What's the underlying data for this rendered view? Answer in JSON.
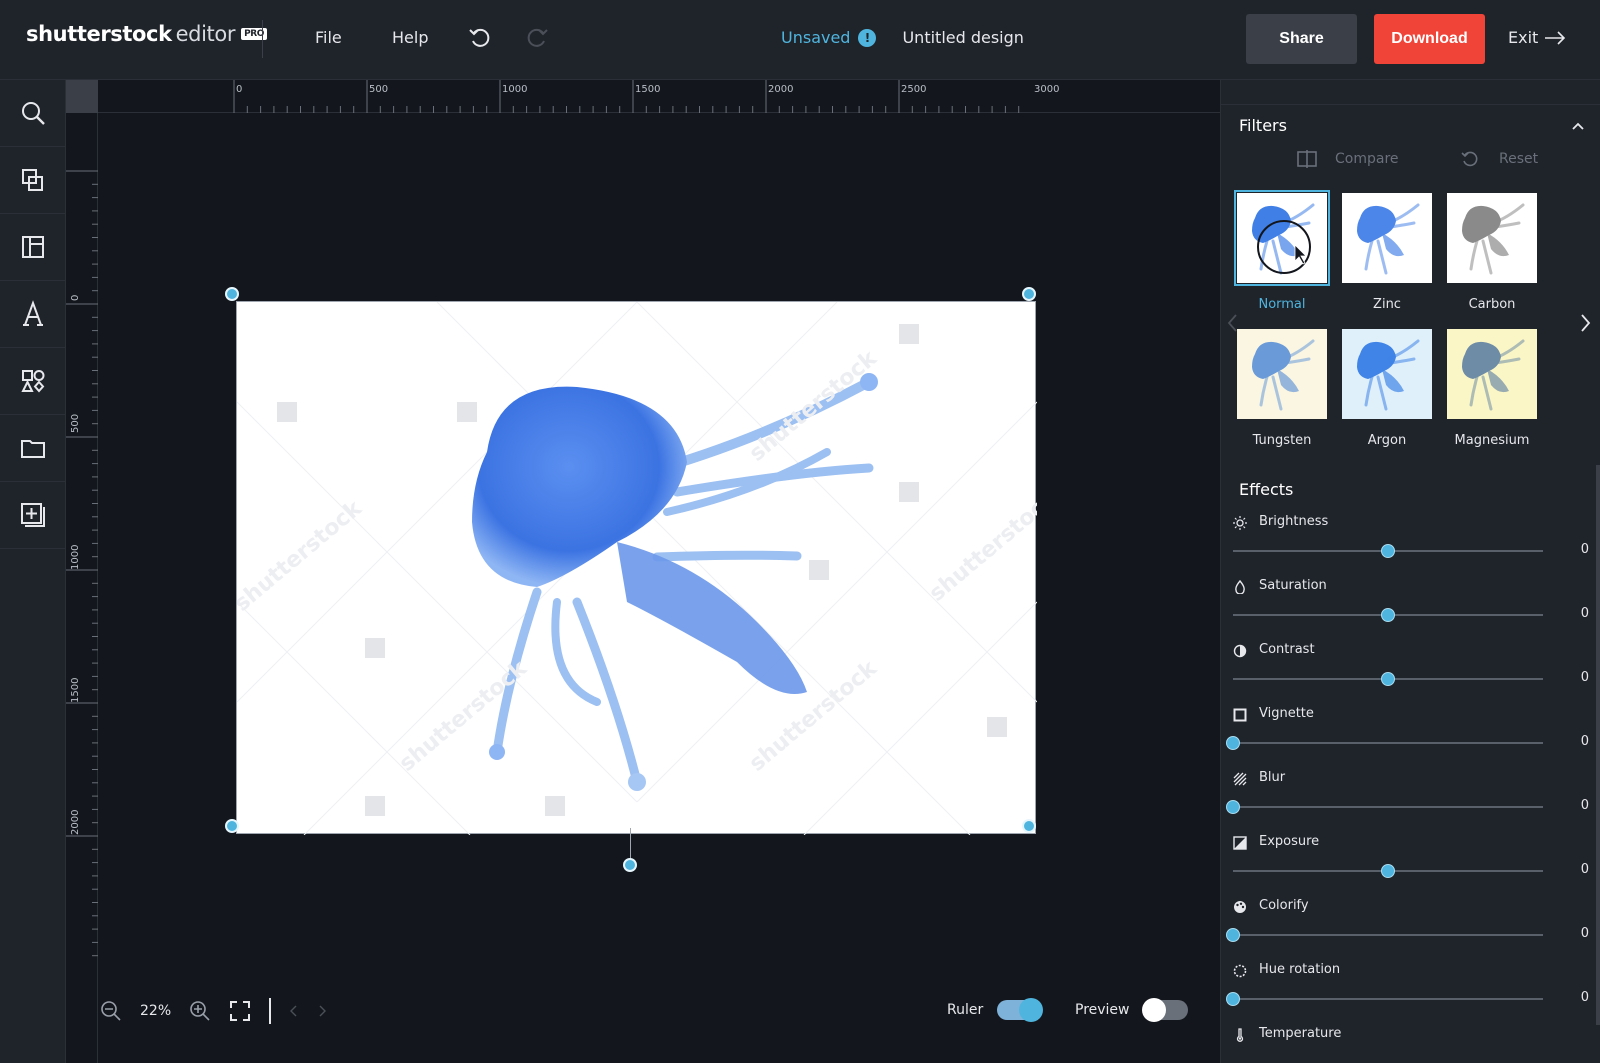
{
  "app": {
    "logo_brand": "shutterstock",
    "logo_editor": "editor",
    "logo_badge": "PRO"
  },
  "menu": {
    "file": "File",
    "help": "Help"
  },
  "status": {
    "unsaved": "Unsaved",
    "warn_glyph": "!",
    "design_title": "Untitled design"
  },
  "actions": {
    "share": "Share",
    "download": "Download",
    "exit": "Exit"
  },
  "colors": {
    "accent": "#4fb5de",
    "download": "#f04438",
    "bg": "#13161c",
    "panel": "#1f232a"
  },
  "rail": [
    {
      "name": "search-icon"
    },
    {
      "name": "resize-icon"
    },
    {
      "name": "templates-icon"
    },
    {
      "name": "text-icon"
    },
    {
      "name": "elements-icon"
    },
    {
      "name": "folder-icon"
    },
    {
      "name": "add-image-icon"
    }
  ],
  "ruler": {
    "top_labels": [
      "0",
      "500",
      "1000",
      "1500",
      "2000",
      "2500",
      "3000"
    ],
    "left_labels": [
      "0",
      "500",
      "1000",
      "1500",
      "2000"
    ]
  },
  "zoom": {
    "level": "22%"
  },
  "toggles": {
    "ruler_label": "Ruler",
    "ruler_on": true,
    "preview_label": "Preview",
    "preview_on": false
  },
  "filters": {
    "title": "Filters",
    "compare": "Compare",
    "reset": "Reset",
    "items": [
      {
        "label": "Normal",
        "active": true,
        "tint": "#3f7fe6",
        "bg": "#ffffff"
      },
      {
        "label": "Zinc",
        "active": false,
        "tint": "#4c86e8",
        "bg": "#ffffff"
      },
      {
        "label": "Carbon",
        "active": false,
        "tint": "#8a8a8a",
        "bg": "#ffffff"
      },
      {
        "label": "Tungsten",
        "active": false,
        "tint": "#6a9ad8",
        "bg": "#faf6e2"
      },
      {
        "label": "Argon",
        "active": false,
        "tint": "#3f84e6",
        "bg": "#dff0fb"
      },
      {
        "label": "Magnesium",
        "active": false,
        "tint": "#6e8ca6",
        "bg": "#fbf6c6"
      }
    ]
  },
  "effects": {
    "title": "Effects",
    "items": [
      {
        "label": "Brightness",
        "icon": "sun-icon",
        "value": "0",
        "level": 0.5
      },
      {
        "label": "Saturation",
        "icon": "drop-icon",
        "value": "0",
        "level": 0.5
      },
      {
        "label": "Contrast",
        "icon": "contrast-icon",
        "value": "0",
        "level": 0.5
      },
      {
        "label": "Vignette",
        "icon": "vignette-icon",
        "value": "0",
        "level": 0
      },
      {
        "label": "Blur",
        "icon": "blur-icon",
        "value": "0",
        "level": 0
      },
      {
        "label": "Exposure",
        "icon": "exposure-icon",
        "value": "0",
        "level": 0.5
      },
      {
        "label": "Colorify",
        "icon": "palette-icon",
        "value": "0",
        "level": 0
      },
      {
        "label": "Hue rotation",
        "icon": "hue-icon",
        "value": "0",
        "level": 0
      },
      {
        "label": "Temperature",
        "icon": "thermometer-icon"
      }
    ]
  }
}
